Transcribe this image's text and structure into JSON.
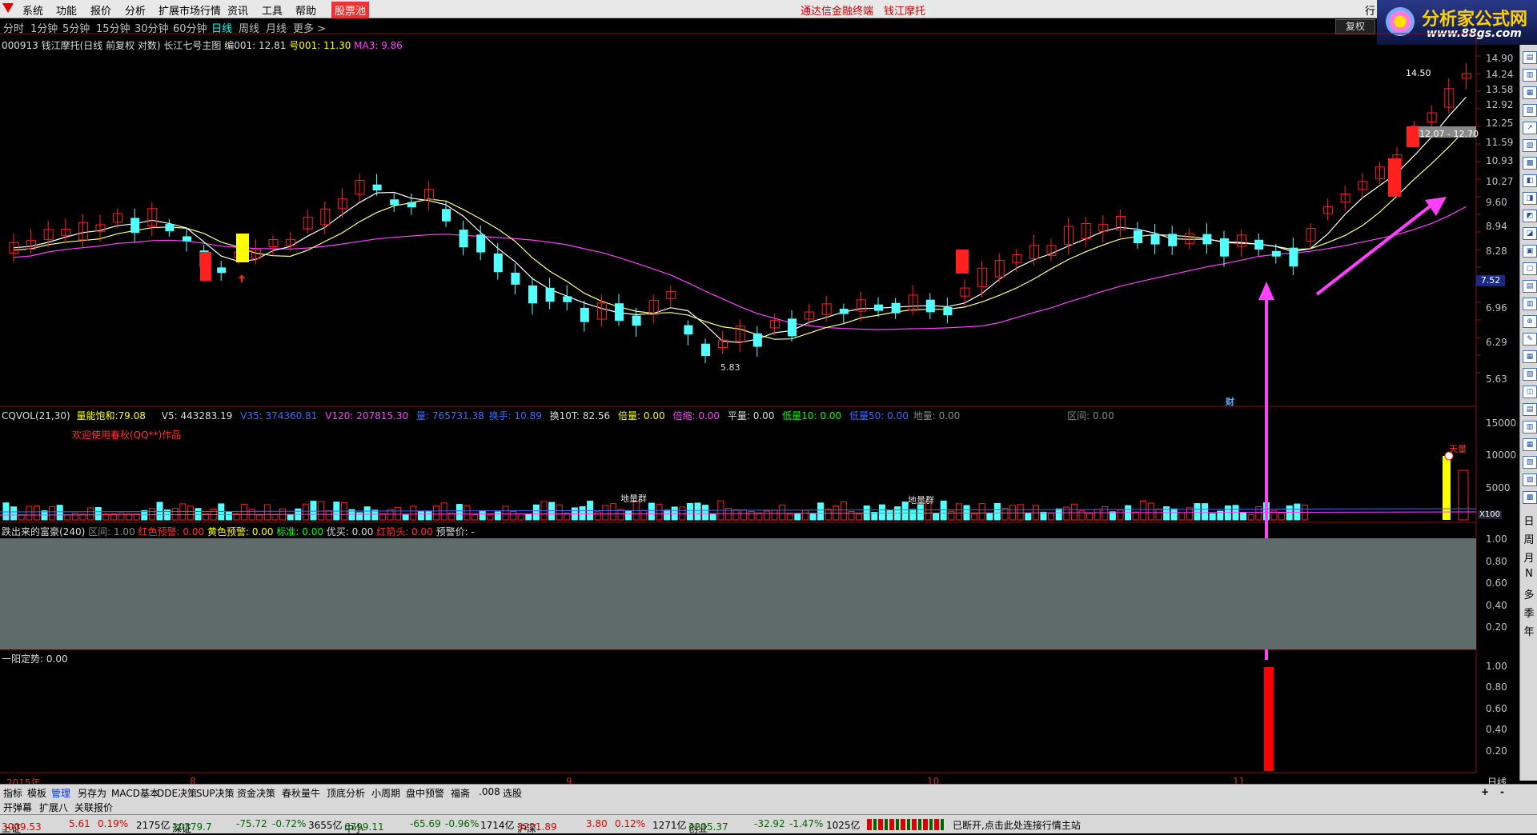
{
  "menu": {
    "items": [
      "系统",
      "功能",
      "报价",
      "分析",
      "扩展市场行情",
      "资讯",
      "工具",
      "帮助"
    ],
    "stock_pool": "股票池",
    "center_text": "通达信金融终端　钱江摩托",
    "right_corner": "行"
  },
  "brand": {
    "name": "分析家公式网",
    "url": "www.88gs.com"
  },
  "periods": {
    "items": [
      "分时",
      "1分钟",
      "5分钟",
      "15分钟",
      "30分钟",
      "60分钟",
      "日线",
      "周线",
      "月线",
      "更多 >"
    ],
    "active": "日线",
    "fuquan": "复权"
  },
  "main_info": {
    "code_name": "000913 钱江摩托(日线 前复权 对数) 长江七号主图",
    "bian_label": "编001: 12.81",
    "hao_label": "号001: 11.30",
    "ma3_label": "MA3: 9.86"
  },
  "price_axis": [
    "14.90",
    "14.24",
    "13.58",
    "12.92",
    "12.25",
    "11.59",
    "10.93",
    "10.27",
    "9.60",
    "8.94",
    "8.28",
    "7.52",
    "6.96",
    "6.29",
    "5.63"
  ],
  "current_price_label": "7.52",
  "annotations": {
    "high_label": "14.50",
    "range_label": "12.07 - 12.70",
    "low_label": "5.83",
    "cai_marker": "财"
  },
  "vol_info": {
    "name": "CQVOL(21,30)",
    "fields": [
      {
        "label": "量能饱和:",
        "value": "79.08",
        "color": "y"
      },
      {
        "label": "V5:",
        "value": "443283.19",
        "color": "w"
      },
      {
        "label": "V35:",
        "value": "374360.81",
        "color": "b"
      },
      {
        "label": "V120:",
        "value": "207815.30",
        "color": "m"
      },
      {
        "label": "量:",
        "value": "765731.38",
        "color": "b"
      },
      {
        "label": "换手:",
        "value": "10.89",
        "color": "b"
      },
      {
        "label": "换10T:",
        "value": "82.56",
        "color": "w"
      },
      {
        "label": "倍量:",
        "value": "0.00",
        "color": "y"
      },
      {
        "label": "倍缩:",
        "value": "0.00",
        "color": "m"
      },
      {
        "label": "平量:",
        "value": "0.00",
        "color": "w"
      },
      {
        "label": "低量10:",
        "value": "0.00",
        "color": "g"
      },
      {
        "label": "低量50:",
        "value": "0.00",
        "color": "b"
      },
      {
        "label": "地量:",
        "value": "0.00",
        "color": "gr"
      },
      {
        "label": "区间:",
        "value": "0.00",
        "color": "gr"
      }
    ],
    "welcome": "欢迎使用春秋(QQ**)作品",
    "diliangqun": "地量群",
    "tianliang": "天量",
    "x100": "X100"
  },
  "vol_axis": [
    "15000",
    "10000",
    "5000"
  ],
  "fc_info": {
    "name": "跌出来的富豪(240)",
    "fields": [
      {
        "label": "区间:",
        "value": "1.00",
        "color": "gr"
      },
      {
        "label": "红色预警:",
        "value": "0.00",
        "color": "r"
      },
      {
        "label": "黄色预警:",
        "value": "0.00",
        "color": "y"
      },
      {
        "label": "标准:",
        "value": "0.00",
        "color": "g"
      },
      {
        "label": "优买:",
        "value": "0.00",
        "color": "w"
      },
      {
        "label": "红箭头:",
        "value": "0.00",
        "color": "r"
      },
      {
        "label": "预警价:",
        "value": "-",
        "color": "w"
      }
    ]
  },
  "ratio_axis": [
    "1.00",
    "0.80",
    "0.60",
    "0.40",
    "0.20"
  ],
  "yy_info": {
    "label": "一阳定势:",
    "value": "0.00"
  },
  "dates": [
    "2015年",
    "8",
    "9",
    "10",
    "11"
  ],
  "period_side": "日线",
  "tabs": [
    "指标",
    "模板",
    "管理",
    "另存为",
    "MACD基本",
    "DDE决策",
    "SUP决策",
    "资金决策",
    "春秋量牛",
    "顶底分析",
    "小周期",
    "盘中预警",
    "福斋",
    ".008",
    "选股"
  ],
  "subtabs": [
    "开弹幕",
    "扩展八",
    "关联报价"
  ],
  "right_tools": [
    "日",
    "周",
    "月",
    "N",
    "多",
    "季",
    "年"
  ],
  "status": {
    "sh": {
      "name": "上证",
      "idx": "3009.53",
      "chg": "5.61",
      "pct": "0.19%",
      "amt": "2175亿"
    },
    "sz": {
      "name": "深证",
      "idx": "10379.7",
      "chg": "-75.72",
      "pct": "-0.72%",
      "amt": "3655亿"
    },
    "zx": {
      "name": "中小",
      "idx": "6799.11",
      "chg": "-65.69",
      "pct": "-0.96%",
      "amt": "1714亿"
    },
    "hs": {
      "name": "沪深",
      "idx": "3221.89",
      "chg": "3.80",
      "pct": "0.12%",
      "amt": "1271亿"
    },
    "cy": {
      "name": "创业",
      "idx": "2205.37",
      "chg": "-32.92",
      "pct": "-1.47%",
      "amt": "1025亿"
    },
    "conn": "已断开,点击此处连接行情主站"
  },
  "colors": {
    "up": "#ff2020",
    "down": "#54ffff",
    "ma5": "#ffffff",
    "ma10": "#ffff80",
    "ma60": "#ff40ff",
    "panel_gray": "#5f6a6a",
    "arrow": "#ff40ff"
  }
}
